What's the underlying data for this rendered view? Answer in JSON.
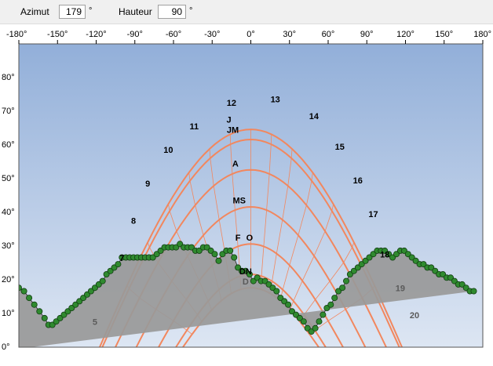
{
  "toolbar": {
    "azimut_label": "Azimut",
    "azimut_value": "179",
    "azimut_unit": "°",
    "hauteur_label": "Hauteur",
    "hauteur_value": "90",
    "hauteur_unit": "°"
  },
  "chart_data": {
    "type": "line",
    "title": "",
    "xlabel": "",
    "ylabel": "",
    "xlim": [
      -180,
      180
    ],
    "ylim": [
      0,
      90
    ],
    "x_ticks": [
      -180,
      -150,
      -120,
      -90,
      -60,
      -30,
      0,
      30,
      60,
      90,
      120,
      150,
      180
    ],
    "x_tick_labels": [
      "-180°",
      "-150°",
      "-120°",
      "-90°",
      "-60°",
      "-30°",
      "0°",
      "30°",
      "60°",
      "90°",
      "120°",
      "150°",
      "180°"
    ],
    "y_ticks": [
      0,
      10,
      20,
      30,
      40,
      50,
      60,
      70,
      80
    ],
    "y_tick_labels": [
      "0°",
      "10°",
      "20°",
      "30°",
      "40°",
      "50°",
      "60°",
      "70°",
      "80°"
    ],
    "colors": {
      "sky_top": "#92afd9",
      "sky_bottom": "#dde6f3",
      "terrain_fill": "#999999",
      "terrain_marker": "#2f8a2f",
      "sun_path": "#f2875e",
      "hour_line": "#f2875e"
    },
    "sun_paths": [
      {
        "max_elevation": 67,
        "rise_azimuth": -120,
        "set_azimuth": 120
      },
      {
        "max_elevation": 64,
        "rise_azimuth": -118,
        "set_azimuth": 118
      },
      {
        "max_elevation": 55,
        "rise_azimuth": -108,
        "set_azimuth": 108
      },
      {
        "max_elevation": 44,
        "rise_azimuth": -92,
        "set_azimuth": 92
      },
      {
        "max_elevation": 33,
        "rise_azimuth": -75,
        "set_azimuth": 75
      },
      {
        "max_elevation": 24,
        "rise_azimuth": -62,
        "set_azimuth": 62
      },
      {
        "max_elevation": 20,
        "rise_azimuth": -57,
        "set_azimuth": 57
      }
    ],
    "hour_labels": [
      {
        "label": "5",
        "azimuth": -121,
        "elevation": 5
      },
      {
        "label": "7",
        "azimuth": -100,
        "elevation": 24
      },
      {
        "label": "8",
        "azimuth": -91,
        "elevation": 35
      },
      {
        "label": "9",
        "azimuth": -80,
        "elevation": 46
      },
      {
        "label": "10",
        "azimuth": -64,
        "elevation": 56
      },
      {
        "label": "11",
        "azimuth": -44,
        "elevation": 63
      },
      {
        "label": "12",
        "azimuth": -15,
        "elevation": 70
      },
      {
        "label": "13",
        "azimuth": 19,
        "elevation": 71
      },
      {
        "label": "14",
        "azimuth": 49,
        "elevation": 66
      },
      {
        "label": "15",
        "azimuth": 69,
        "elevation": 57
      },
      {
        "label": "16",
        "azimuth": 83,
        "elevation": 47
      },
      {
        "label": "17",
        "azimuth": 95,
        "elevation": 37
      },
      {
        "label": "18",
        "azimuth": 104,
        "elevation": 25
      },
      {
        "label": "19",
        "azimuth": 116,
        "elevation": 15
      },
      {
        "label": "20",
        "azimuth": 127,
        "elevation": 7
      }
    ],
    "month_labels": [
      {
        "label": "J",
        "azimuth": -17,
        "elevation": 65
      },
      {
        "label": "JM",
        "azimuth": -14,
        "elevation": 62
      },
      {
        "label": "A",
        "azimuth": -12,
        "elevation": 52
      },
      {
        "label": "MS",
        "azimuth": -9,
        "elevation": 41
      },
      {
        "label": "F",
        "azimuth": -10,
        "elevation": 30
      },
      {
        "label": "O",
        "azimuth": -1,
        "elevation": 30
      },
      {
        "label": "DN",
        "azimuth": -4,
        "elevation": 20
      },
      {
        "label": "D",
        "azimuth": -4,
        "elevation": 17
      }
    ],
    "horizon_profile": {
      "azimuth": [
        -180,
        -176,
        -172,
        -168,
        -164,
        -160,
        -157,
        -154,
        -151,
        -148,
        -145,
        -142,
        -139,
        -136,
        -133,
        -130,
        -127,
        -124,
        -121,
        -118,
        -115,
        -112,
        -109,
        -106,
        -103,
        -100,
        -97,
        -94,
        -91,
        -88,
        -85,
        -82,
        -79,
        -76,
        -73,
        -70,
        -67,
        -64,
        -61,
        -58,
        -55,
        -52,
        -49,
        -46,
        -43,
        -40,
        -37,
        -34,
        -31,
        -28,
        -25,
        -22,
        -19,
        -16,
        -13,
        -10,
        -7,
        -4,
        -1,
        2,
        5,
        8,
        11,
        14,
        17,
        20,
        23,
        26,
        29,
        32,
        35,
        38,
        41,
        44,
        47,
        50,
        53,
        56,
        59,
        62,
        65,
        68,
        71,
        74,
        77,
        80,
        83,
        86,
        89,
        92,
        95,
        98,
        101,
        104,
        107,
        110,
        113,
        116,
        119,
        122,
        125,
        128,
        131,
        134,
        137,
        140,
        143,
        146,
        149,
        152,
        155,
        158,
        161,
        164,
        167,
        170,
        173,
        176,
        180
      ],
      "elevation": [
        16,
        15,
        13,
        11,
        9,
        7,
        5,
        5,
        6,
        7,
        8,
        9,
        10,
        11,
        12,
        13,
        14,
        15,
        16,
        17,
        18,
        20,
        21,
        22,
        23,
        25,
        25,
        25,
        25,
        25,
        25,
        25,
        25,
        25,
        26,
        27,
        28,
        28,
        28,
        28,
        29,
        28,
        28,
        28,
        27,
        27,
        28,
        28,
        27,
        26,
        24,
        26,
        27,
        27,
        25,
        22,
        21,
        21,
        20,
        18,
        19,
        18,
        18,
        17,
        16,
        15,
        13,
        12,
        11,
        9,
        8,
        7,
        6,
        4,
        3,
        4,
        6,
        8,
        10,
        11,
        13,
        15,
        16,
        18,
        20,
        21,
        22,
        23,
        24,
        25,
        26,
        27,
        27,
        27,
        26,
        25,
        26,
        27,
        27,
        26,
        25,
        24,
        23,
        23,
        22,
        22,
        21,
        20,
        20,
        19,
        19,
        18,
        17,
        17,
        16,
        15,
        15
      ]
    }
  }
}
